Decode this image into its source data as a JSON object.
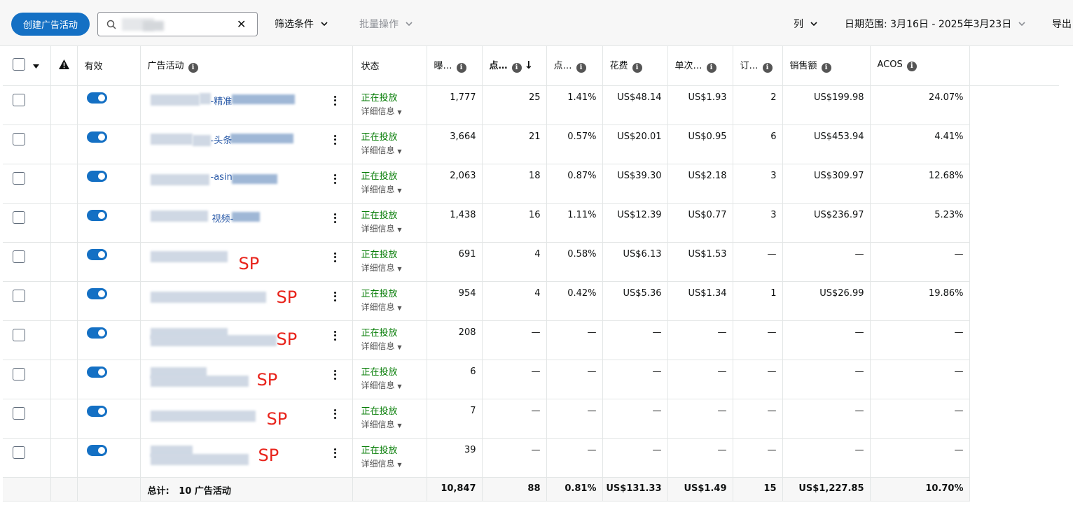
{
  "toolbar": {
    "create_label": "创建广告活动",
    "filter_label": "筛选条件",
    "bulk_label": "批量操作",
    "columns_label": "列",
    "date_range_label": "日期范围: 3月16日 - 2025年3月23日",
    "export_label": "导出"
  },
  "columns": {
    "active": "有效",
    "campaign": "广告活动",
    "status": "状态",
    "impressions": "曝…",
    "clicks": "点…",
    "ctr": "点…",
    "spend": "花费",
    "cpc": "单次…",
    "orders": "订…",
    "sales": "销售额",
    "acos": "ACOS"
  },
  "rows": [
    {
      "name_part": "-精准",
      "sp": "",
      "status": "正在投放",
      "details": "详细信息",
      "impressions": "1,777",
      "clicks": "25",
      "ctr": "1.41%",
      "spend": "US$48.14",
      "cpc": "US$1.93",
      "orders": "2",
      "sales": "US$199.98",
      "acos": "24.07%"
    },
    {
      "name_part": "-头条",
      "sp": "",
      "status": "正在投放",
      "details": "详细信息",
      "impressions": "3,664",
      "clicks": "21",
      "ctr": "0.57%",
      "spend": "US$20.01",
      "cpc": "US$0.95",
      "orders": "6",
      "sales": "US$453.94",
      "acos": "4.41%"
    },
    {
      "name_part": "-asin",
      "sp": "",
      "status": "正在投放",
      "details": "详细信息",
      "impressions": "2,063",
      "clicks": "18",
      "ctr": "0.87%",
      "spend": "US$39.30",
      "cpc": "US$2.18",
      "orders": "3",
      "sales": "US$309.97",
      "acos": "12.68%"
    },
    {
      "name_part": "视频-",
      "sp": "",
      "status": "正在投放",
      "details": "详细信息",
      "impressions": "1,438",
      "clicks": "16",
      "ctr": "1.11%",
      "spend": "US$12.39",
      "cpc": "US$0.77",
      "orders": "3",
      "sales": "US$236.97",
      "acos": "5.23%"
    },
    {
      "name_part": "",
      "sp": "SP",
      "status": "正在投放",
      "details": "详细信息",
      "impressions": "691",
      "clicks": "4",
      "ctr": "0.58%",
      "spend": "US$6.13",
      "cpc": "US$1.53",
      "orders": "—",
      "sales": "—",
      "acos": "—"
    },
    {
      "name_part": "",
      "sp": "SP",
      "status": "正在投放",
      "details": "详细信息",
      "impressions": "954",
      "clicks": "4",
      "ctr": "0.42%",
      "spend": "US$5.36",
      "cpc": "US$1.34",
      "orders": "1",
      "sales": "US$26.99",
      "acos": "19.86%"
    },
    {
      "name_part": "",
      "sp": "SP",
      "status": "正在投放",
      "details": "详细信息",
      "impressions": "208",
      "clicks": "—",
      "ctr": "—",
      "spend": "—",
      "cpc": "—",
      "orders": "—",
      "sales": "—",
      "acos": "—"
    },
    {
      "name_part": "",
      "sp": "SP",
      "status": "正在投放",
      "details": "详细信息",
      "impressions": "6",
      "clicks": "—",
      "ctr": "—",
      "spend": "—",
      "cpc": "—",
      "orders": "—",
      "sales": "—",
      "acos": "—"
    },
    {
      "name_part": "",
      "sp": "SP",
      "status": "正在投放",
      "details": "详细信息",
      "impressions": "7",
      "clicks": "—",
      "ctr": "—",
      "spend": "—",
      "cpc": "—",
      "orders": "—",
      "sales": "—",
      "acos": "—"
    },
    {
      "name_part": "",
      "sp": "SP",
      "status": "正在投放",
      "details": "详细信息",
      "impressions": "39",
      "clicks": "—",
      "ctr": "—",
      "spend": "—",
      "cpc": "—",
      "orders": "—",
      "sales": "—",
      "acos": "—"
    }
  ],
  "totals": {
    "label": "总计:   10 广告活动",
    "impressions": "10,847",
    "clicks": "88",
    "ctr": "0.81%",
    "spend": "US$131.33",
    "cpc": "US$1.49",
    "orders": "15",
    "sales": "US$1,227.85",
    "acos": "10.70%"
  },
  "colors": {
    "accent": "#1470c4",
    "status_green": "#067d06",
    "annotation_red": "#e8241c"
  }
}
